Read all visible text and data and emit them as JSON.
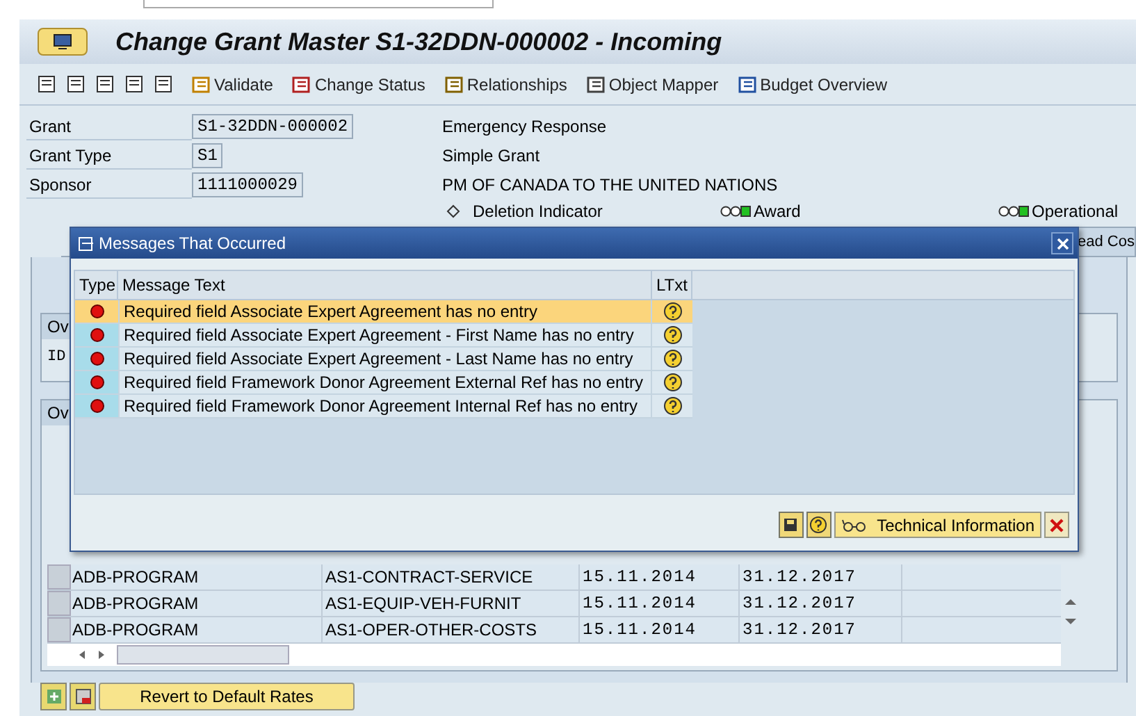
{
  "window": {
    "title": "Change Grant Master S1-32DDN-000002  - Incoming"
  },
  "toolbar": {
    "buttons": [
      {
        "label": "Validate",
        "kind": "validate"
      },
      {
        "label": "Change Status",
        "kind": "status"
      },
      {
        "label": "Relationships",
        "kind": "relationships"
      },
      {
        "label": "Object Mapper",
        "kind": "mapper"
      },
      {
        "label": "Budget Overview",
        "kind": "budget"
      }
    ]
  },
  "header": {
    "fields": [
      {
        "label": "Grant",
        "value": "S1-32DDN-000002",
        "description": "Emergency Response"
      },
      {
        "label": "Grant Type",
        "value": "S1",
        "description": "Simple Grant"
      },
      {
        "label": "Sponsor",
        "value": "1111000029",
        "description": "PM OF CANADA TO THE UNITED NATIONS"
      }
    ]
  },
  "indicators": [
    {
      "label": "Deletion Indicator",
      "kind": "diamond"
    },
    {
      "label": "Award",
      "kind": "lights"
    },
    {
      "label": "Operational",
      "kind": "lights"
    }
  ],
  "tabstrip": {
    "visible_tab": "ead Cos"
  },
  "sections": [
    {
      "tab": "Ov",
      "field": "ID"
    },
    {
      "tab": "Ov"
    }
  ],
  "table": {
    "rows": [
      {
        "column_1": "ADB-PROGRAM",
        "column_2": "AS1-CONTRACT-SERVICE",
        "column_3": "15.11.2014",
        "column_4": "31.12.2017"
      },
      {
        "column_1": "ADB-PROGRAM",
        "column_2": "AS1-EQUIP-VEH-FURNIT",
        "column_3": "15.11.2014",
        "column_4": "31.12.2017"
      },
      {
        "column_1": "ADB-PROGRAM",
        "column_2": "AS1-OPER-OTHER-COSTS",
        "column_3": "15.11.2014",
        "column_4": "31.12.2017"
      }
    ]
  },
  "buttons": [
    {
      "label": "Revert to Default Rates"
    }
  ],
  "dialog": {
    "title": "Messages That Occurred",
    "columns": [
      "Type",
      "Message Text",
      "LTxt"
    ],
    "messages": [
      {
        "kind": "error",
        "text": "Required field Associate Expert Agreement has no entry",
        "selected": true
      },
      {
        "kind": "error",
        "text": "Required field Associate Expert Agreement - First Name has no entry",
        "selected": false
      },
      {
        "kind": "error",
        "text": "Required field Associate Expert Agreement - Last Name has no entry",
        "selected": false
      },
      {
        "kind": "error",
        "text": "Required field Framework Donor Agreement External Ref has no entry",
        "selected": false
      },
      {
        "kind": "error",
        "text": "Required field Framework Donor Agreement Internal Ref has no entry",
        "selected": false
      }
    ],
    "footer_button": "Technical Information"
  }
}
